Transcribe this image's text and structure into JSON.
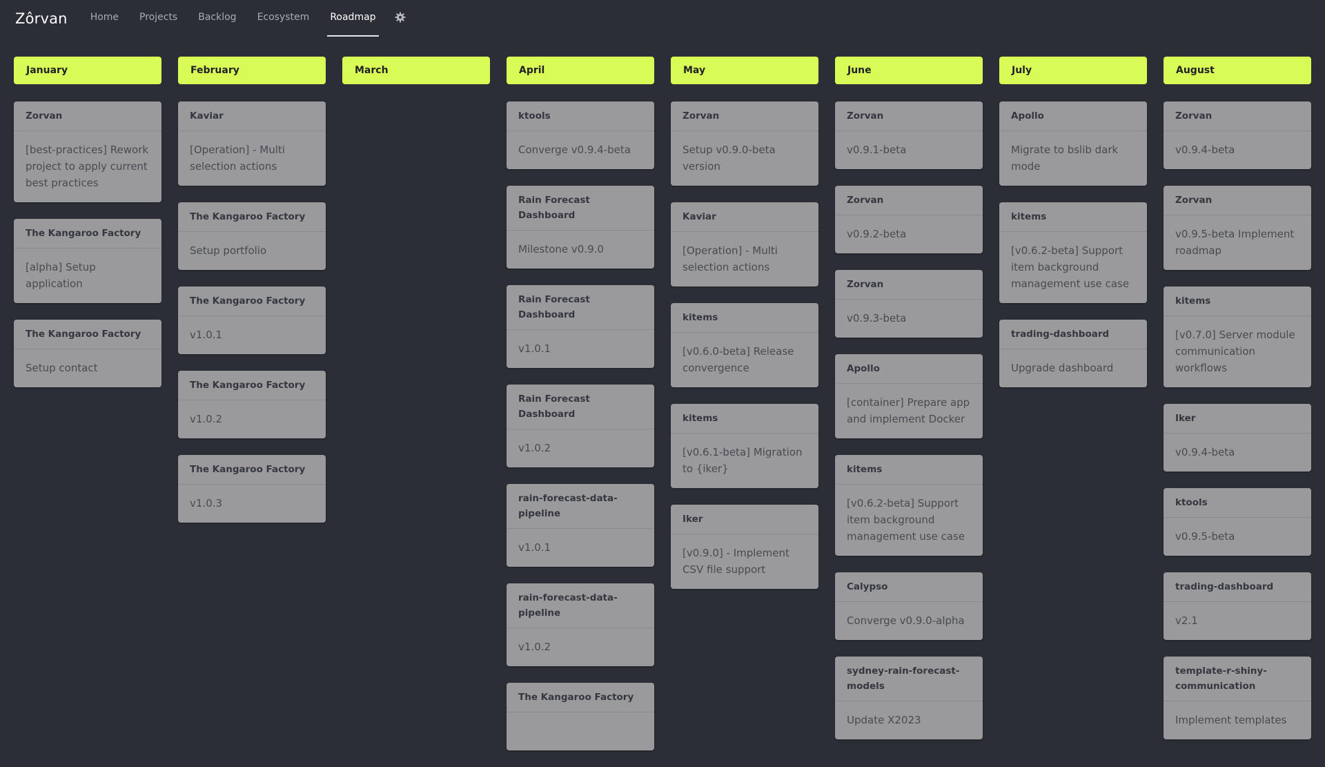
{
  "nav": {
    "brand": "Zôrvan",
    "links": [
      "Home",
      "Projects",
      "Backlog",
      "Ecosystem",
      "Roadmap"
    ],
    "active": "Roadmap",
    "settings_icon": "gear-icon"
  },
  "colors": {
    "background": "#2b2e36",
    "month_header": "#d8fb55",
    "card": "#9a9a9c"
  },
  "columns": [
    {
      "month": "January",
      "cards": [
        {
          "project": "Zorvan",
          "item": "[best-practices] Rework project to apply current best practices"
        },
        {
          "project": "The Kangaroo Factory",
          "item": "[alpha] Setup application"
        },
        {
          "project": "The Kangaroo Factory",
          "item": "Setup contact"
        }
      ]
    },
    {
      "month": "February",
      "cards": [
        {
          "project": "Kaviar",
          "item": "[Operation] - Multi selection actions"
        },
        {
          "project": "The Kangaroo Factory",
          "item": "Setup portfolio"
        },
        {
          "project": "The Kangaroo Factory",
          "item": "v1.0.1"
        },
        {
          "project": "The Kangaroo Factory",
          "item": "v1.0.2"
        },
        {
          "project": "The Kangaroo Factory",
          "item": "v1.0.3"
        }
      ]
    },
    {
      "month": "March",
      "cards": []
    },
    {
      "month": "April",
      "cards": [
        {
          "project": "ktools",
          "item": "Converge v0.9.4-beta"
        },
        {
          "project": "Rain Forecast Dashboard",
          "item": "Milestone v0.9.0"
        },
        {
          "project": "Rain Forecast Dashboard",
          "item": "v1.0.1"
        },
        {
          "project": "Rain Forecast Dashboard",
          "item": "v1.0.2"
        },
        {
          "project": "rain-forecast-data-pipeline",
          "item": "v1.0.1"
        },
        {
          "project": "rain-forecast-data-pipeline",
          "item": "v1.0.2"
        },
        {
          "project": "The Kangaroo Factory",
          "item": ""
        }
      ]
    },
    {
      "month": "May",
      "cards": [
        {
          "project": "Zorvan",
          "item": "Setup v0.9.0-beta version"
        },
        {
          "project": "Kaviar",
          "item": "[Operation] - Multi selection actions"
        },
        {
          "project": "kitems",
          "item": "[v0.6.0-beta] Release convergence"
        },
        {
          "project": "kitems",
          "item": "[v0.6.1-beta] Migration to {iker}"
        },
        {
          "project": "Iker",
          "item": "[v0.9.0] - Implement CSV file support"
        }
      ]
    },
    {
      "month": "June",
      "cards": [
        {
          "project": "Zorvan",
          "item": "v0.9.1-beta"
        },
        {
          "project": "Zorvan",
          "item": "v0.9.2-beta"
        },
        {
          "project": "Zorvan",
          "item": "v0.9.3-beta"
        },
        {
          "project": "Apollo",
          "item": "[container] Prepare app and implement Docker"
        },
        {
          "project": "kitems",
          "item": "[v0.6.2-beta] Support item background management use case"
        },
        {
          "project": "Calypso",
          "item": "Converge v0.9.0-alpha"
        },
        {
          "project": "sydney-rain-forecast-models",
          "item": "Update X2023"
        }
      ]
    },
    {
      "month": "July",
      "cards": [
        {
          "project": "Apollo",
          "item": "Migrate to bslib dark mode"
        },
        {
          "project": "kitems",
          "item": "[v0.6.2-beta] Support item background management use case"
        },
        {
          "project": "trading-dashboard",
          "item": "Upgrade dashboard"
        }
      ]
    },
    {
      "month": "August",
      "cards": [
        {
          "project": "Zorvan",
          "item": "v0.9.4-beta"
        },
        {
          "project": "Zorvan",
          "item": "v0.9.5-beta Implement roadmap"
        },
        {
          "project": "kitems",
          "item": "[v0.7.0] Server module communication workflows"
        },
        {
          "project": "Iker",
          "item": "v0.9.4-beta"
        },
        {
          "project": "ktools",
          "item": "v0.9.5-beta"
        },
        {
          "project": "trading-dashboard",
          "item": "v2.1"
        },
        {
          "project": "template-r-shiny-communication",
          "item": "Implement templates"
        }
      ]
    }
  ]
}
